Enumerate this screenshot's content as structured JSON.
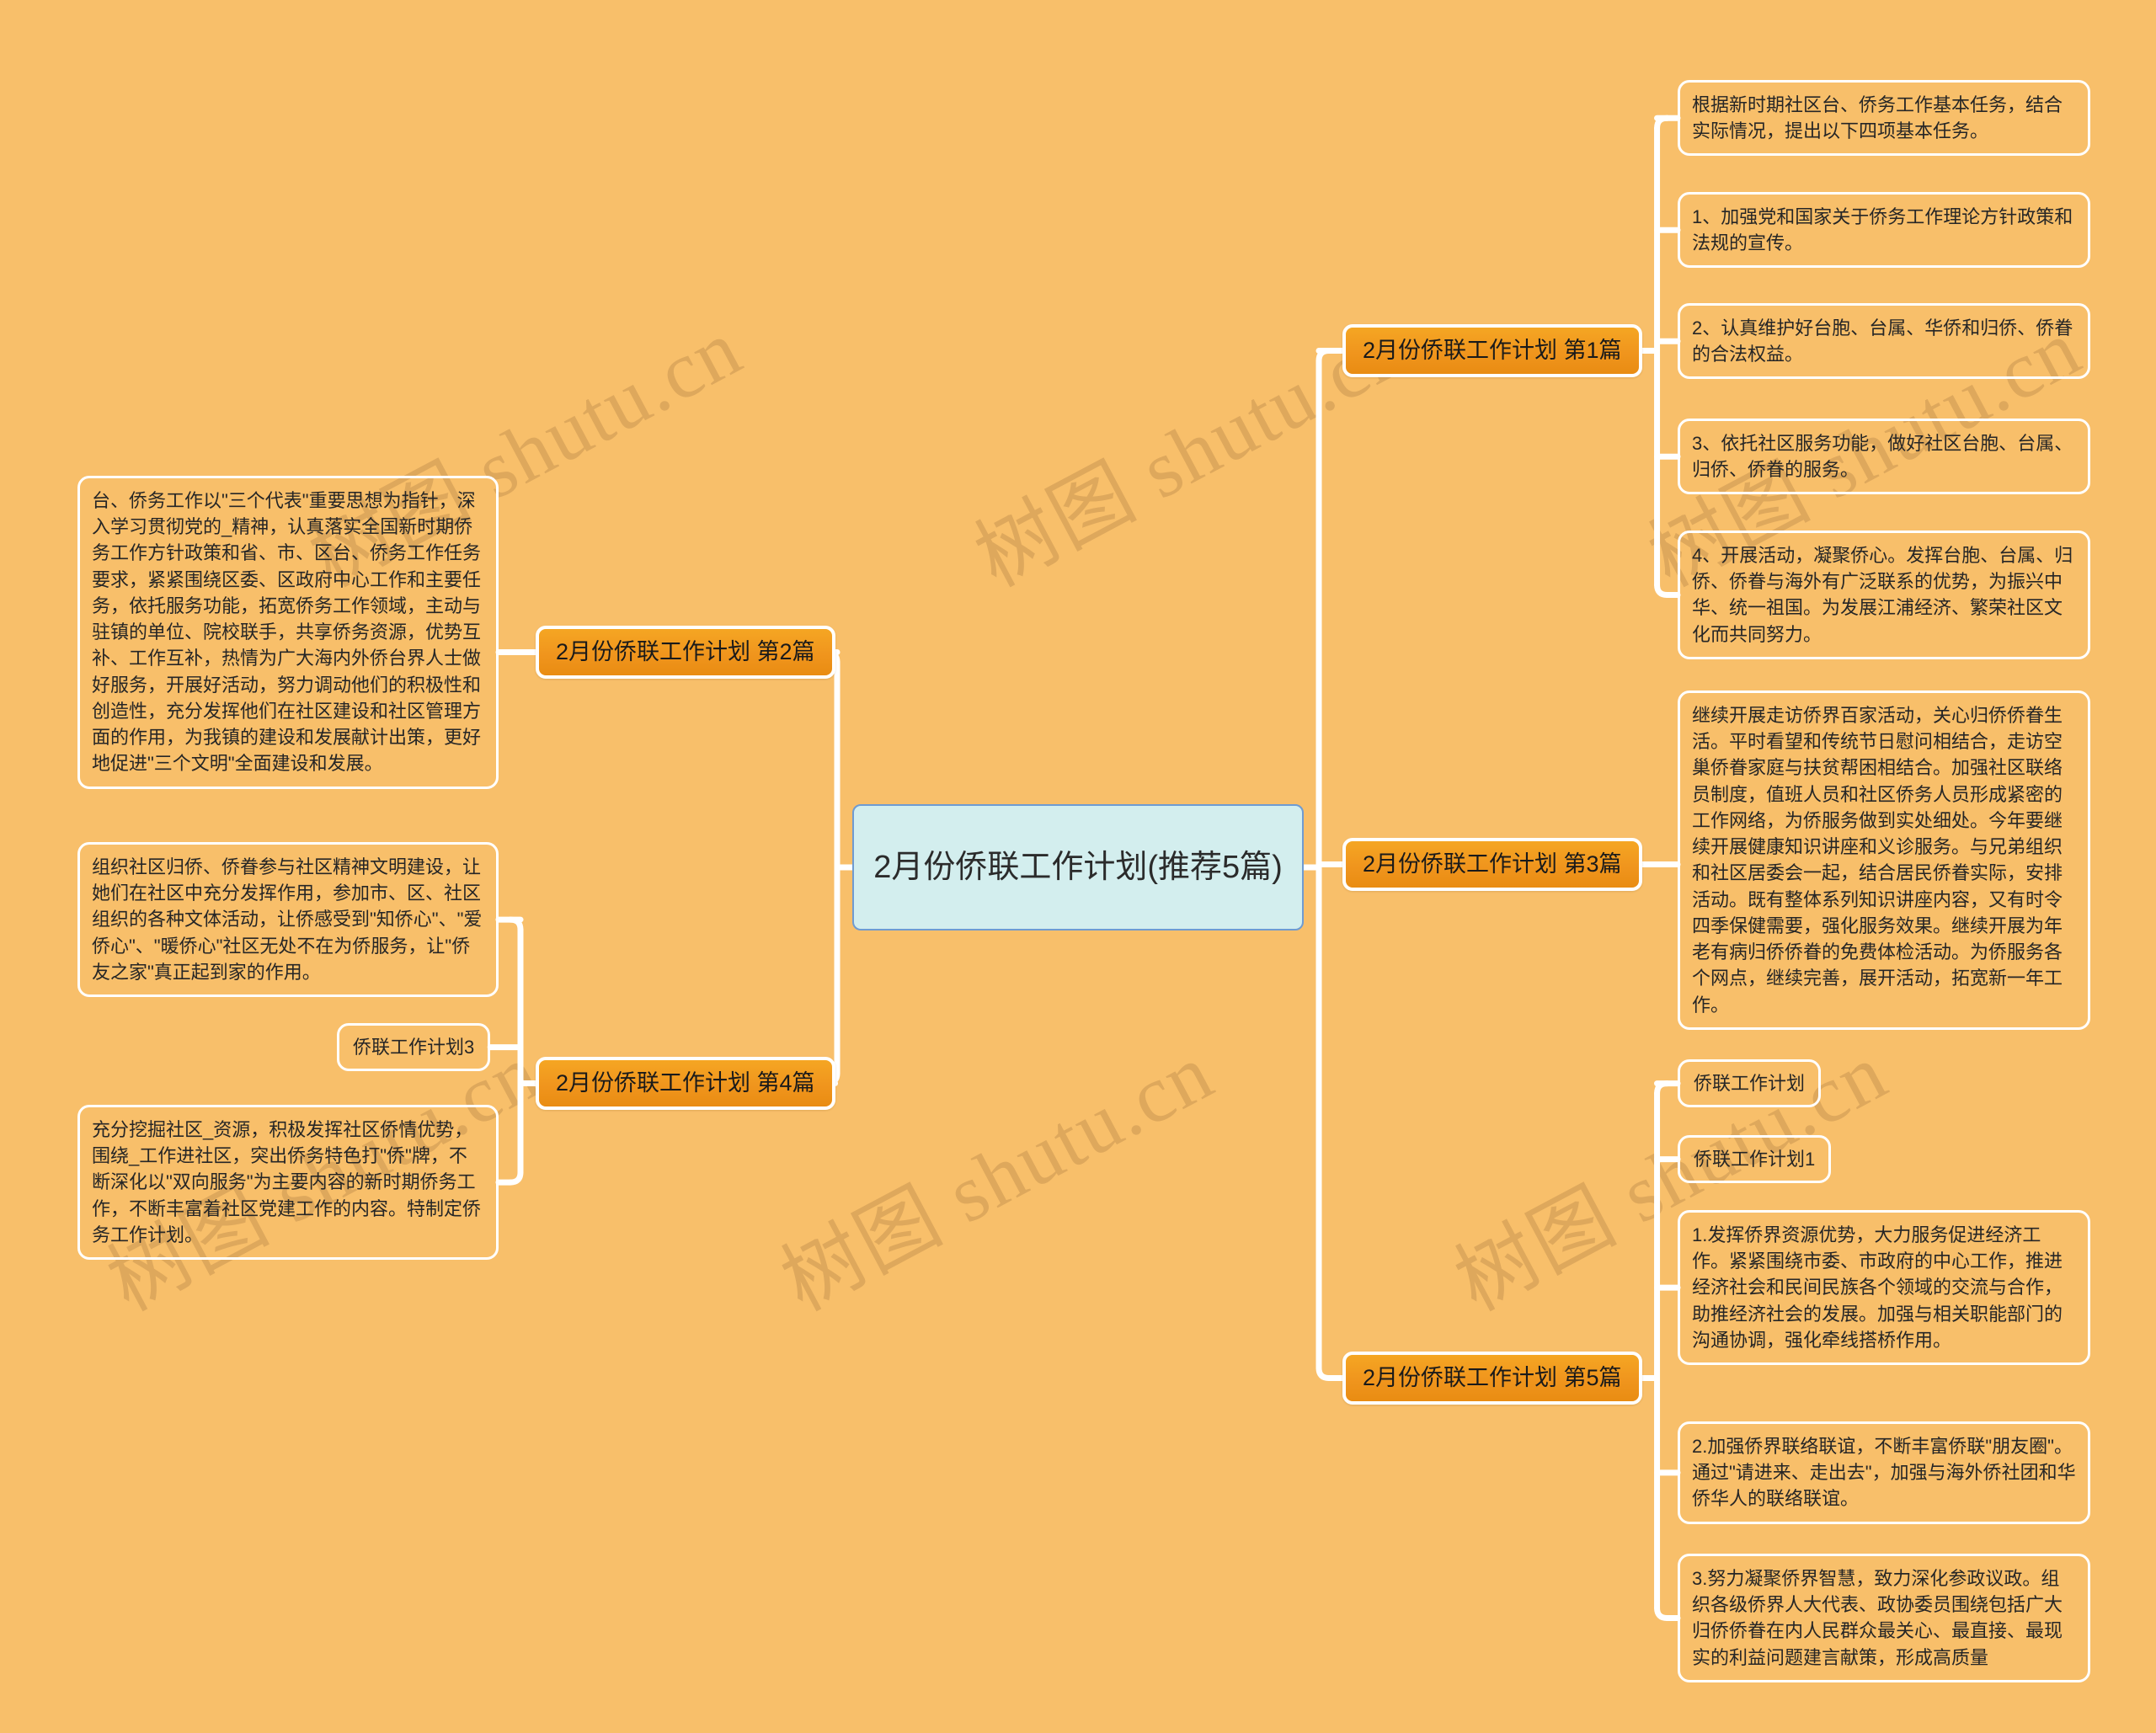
{
  "theme": {
    "background": "#f8bf6a",
    "branch_fill": "#f0951d",
    "branch_border": "#ffffff",
    "root_fill": "#d3eeee",
    "root_border": "#6f9bd1",
    "link_color": "#ffffff",
    "watermark_color": "#d9a359"
  },
  "watermark": {
    "text": "树图 shutu.cn"
  },
  "root": {
    "title": "2月份侨联工作计划(推荐5篇)"
  },
  "branches": {
    "b1": {
      "label": "2月份侨联工作计划 第1篇"
    },
    "b2": {
      "label": "2月份侨联工作计划 第2篇"
    },
    "b3": {
      "label": "2月份侨联工作计划 第3篇"
    },
    "b4": {
      "label": "2月份侨联工作计划 第4篇"
    },
    "b5": {
      "label": "2月份侨联工作计划 第5篇"
    }
  },
  "leaves": {
    "r1": "根据新时期社区台、侨务工作基本任务，结合实际情况，提出以下四项基本任务。",
    "r2": "1、加强党和国家关于侨务工作理论方针政策和法规的宣传。",
    "r3": "2、认真维护好台胞、台属、华侨和归侨、侨眷的合法权益。",
    "r4": "3、依托社区服务功能，做好社区台胞、台属、归侨、侨眷的服务。",
    "r5": "4、开展活动，凝聚侨心。发挥台胞、台属、归侨、侨眷与海外有广泛联系的优势，为振兴中华、统一祖国。为发展江浦经济、繁荣社区文化而共同努力。",
    "r6": "继续开展走访侨界百家活动，关心归侨侨眷生活。平时看望和传统节日慰问相结合，走访空巢侨眷家庭与扶贫帮困相结合。加强社区联络员制度，值班人员和社区侨务人员形成紧密的工作网络，为侨服务做到实处细处。今年要继续开展健康知识讲座和义诊服务。与兄弟组织和社区居委会一起，结合居民侨眷实际，安排活动。既有整体系列知识讲座内容，又有时令四季保健需要，强化服务效果。继续开展为年老有病归侨侨眷的免费体检活动。为侨服务各个网点，继续完善，展开活动，拓宽新一年工作。",
    "r7": "侨联工作计划",
    "r8": "侨联工作计划1",
    "r9": "1.发挥侨界资源优势，大力服务促进经济工作。紧紧围绕市委、市政府的中心工作，推进经济社会和民间民族各个领域的交流与合作，助推经济社会的发展。加强与相关职能部门的沟通协调，强化牵线搭桥作用。",
    "r10": "2.加强侨界联络联谊，不断丰富侨联\"朋友圈\"。通过\"请进来、走出去\"，加强与海外侨社团和华侨华人的联络联谊。",
    "r11": "3.努力凝聚侨界智慧，致力深化参政议政。组织各级侨界人大代表、政协委员围绕包括广大归侨侨眷在内人民群众最关心、最直接、最现实的利益问题建言献策，形成高质量",
    "l1": "台、侨务工作以\"三个代表\"重要思想为指针，深入学习贯彻党的_精神，认真落实全国新时期侨务工作方针政策和省、市、区台、侨务工作任务要求，紧紧围绕区委、区政府中心工作和主要任务，依托服务功能，拓宽侨务工作领域，主动与驻镇的单位、院校联手，共享侨务资源，优势互补、工作互补，热情为广大海内外侨台界人士做好服务，开展好活动，努力调动他们的积极性和创造性，充分发挥他们在社区建设和社区管理方面的作用，为我镇的建设和发展献计出策，更好地促进\"三个文明\"全面建设和发展。",
    "l2": "组织社区归侨、侨眷参与社区精神文明建设，让她们在社区中充分发挥作用，参加市、区、社区组织的各种文体活动，让侨感受到\"知侨心\"、\"爱侨心\"、\"暖侨心\"社区无处不在为侨服务，让\"侨友之家\"真正起到家的作用。",
    "l3": "侨联工作计划3",
    "l4": "充分挖掘社区_资源，积极发挥社区侨情优势，围绕_工作进社区，突出侨务特色打\"侨\"牌，不断深化以\"双向服务\"为主要内容的新时期侨务工作，不断丰富着社区党建工作的内容。特制定侨务工作计划。"
  }
}
